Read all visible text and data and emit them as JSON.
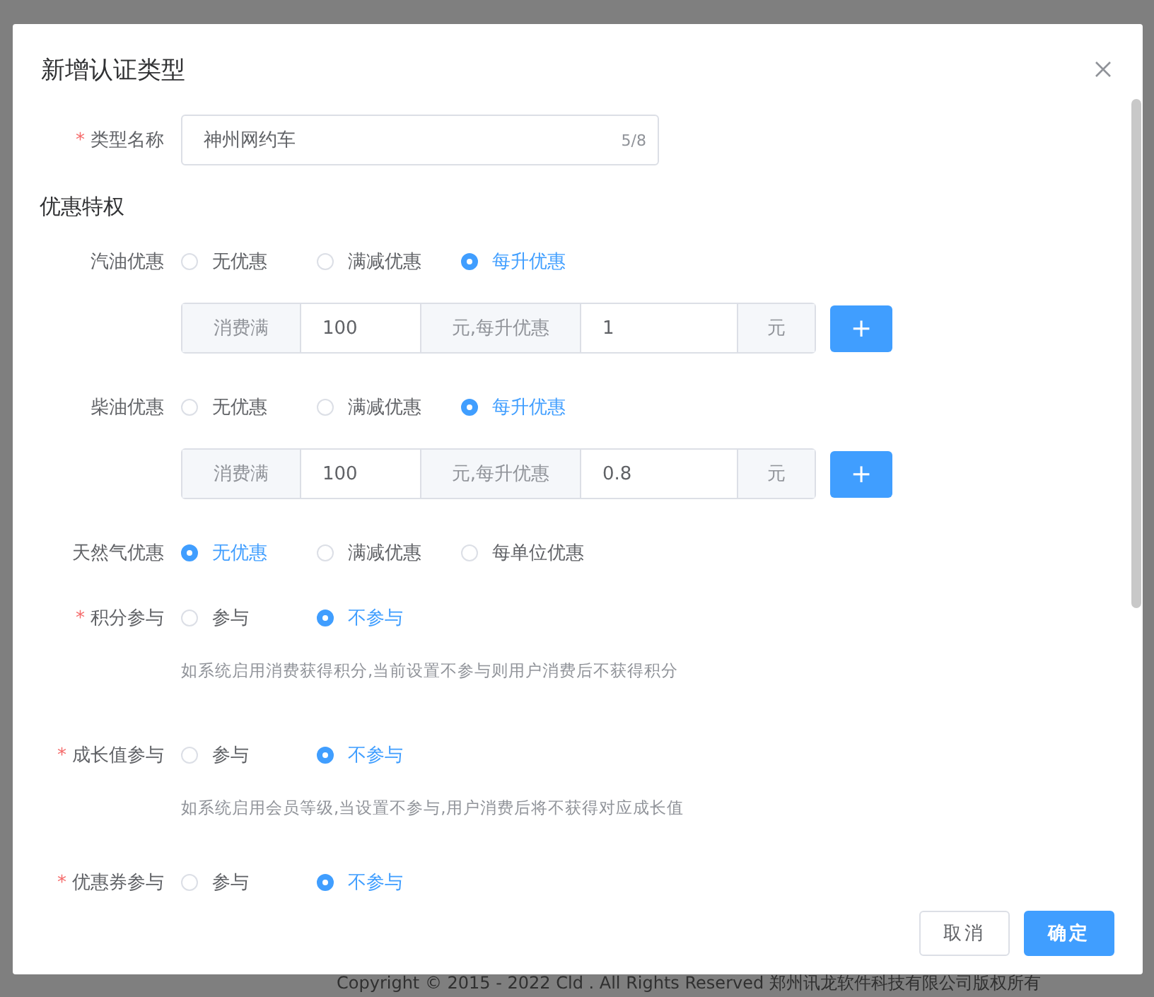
{
  "dialog": {
    "title": "新增认证类型"
  },
  "type_name": {
    "label": "类型名称",
    "required_mark": "*",
    "value": "神州网约车",
    "counter": "5/8"
  },
  "section_title": "优惠特权",
  "rows": [
    {
      "label": "汽油优惠",
      "options": [
        {
          "label": "无优惠",
          "selected": false
        },
        {
          "label": "满减优惠",
          "selected": false
        },
        {
          "label": "每升优惠",
          "selected": true
        }
      ],
      "tier": {
        "prefix": "消费满",
        "amount": "100",
        "middle": "元,每升优惠",
        "discount": "1",
        "suffix": "元",
        "add_button": "+"
      }
    },
    {
      "label": "柴油优惠",
      "options": [
        {
          "label": "无优惠",
          "selected": false
        },
        {
          "label": "满减优惠",
          "selected": false
        },
        {
          "label": "每升优惠",
          "selected": true
        }
      ],
      "tier": {
        "prefix": "消费满",
        "amount": "100",
        "middle": "元,每升优惠",
        "discount": "0.8",
        "suffix": "元",
        "add_button": "+"
      }
    },
    {
      "label": "天然气优惠",
      "options": [
        {
          "label": "无优惠",
          "selected": true
        },
        {
          "label": "满减优惠",
          "selected": false
        },
        {
          "label": "每单位优惠",
          "selected": false
        }
      ]
    },
    {
      "label": "积分参与",
      "required_mark": "*",
      "options": [
        {
          "label": "参与",
          "selected": false
        },
        {
          "label": "不参与",
          "selected": true
        }
      ],
      "hint": "如系统启用消费获得积分,当前设置不参与则用户消费后不获得积分"
    },
    {
      "label": "成长值参与",
      "required_mark": "*",
      "options": [
        {
          "label": "参与",
          "selected": false
        },
        {
          "label": "不参与",
          "selected": true
        }
      ],
      "hint": "如系统启用会员等级,当设置不参与,用户消费后将不获得对应成长值"
    },
    {
      "label": "优惠券参与",
      "required_mark": "*",
      "options": [
        {
          "label": "参与",
          "selected": false
        },
        {
          "label": "不参与",
          "selected": true
        }
      ]
    }
  ],
  "buttons": [
    {
      "label": "取消",
      "kind": "default"
    },
    {
      "label": "确定",
      "kind": "primary"
    }
  ],
  "footer_text": "Copyright © 2015 - 2022 Cld . All Rights Reserved 郑州讯龙软件科技有限公司版权所有"
}
